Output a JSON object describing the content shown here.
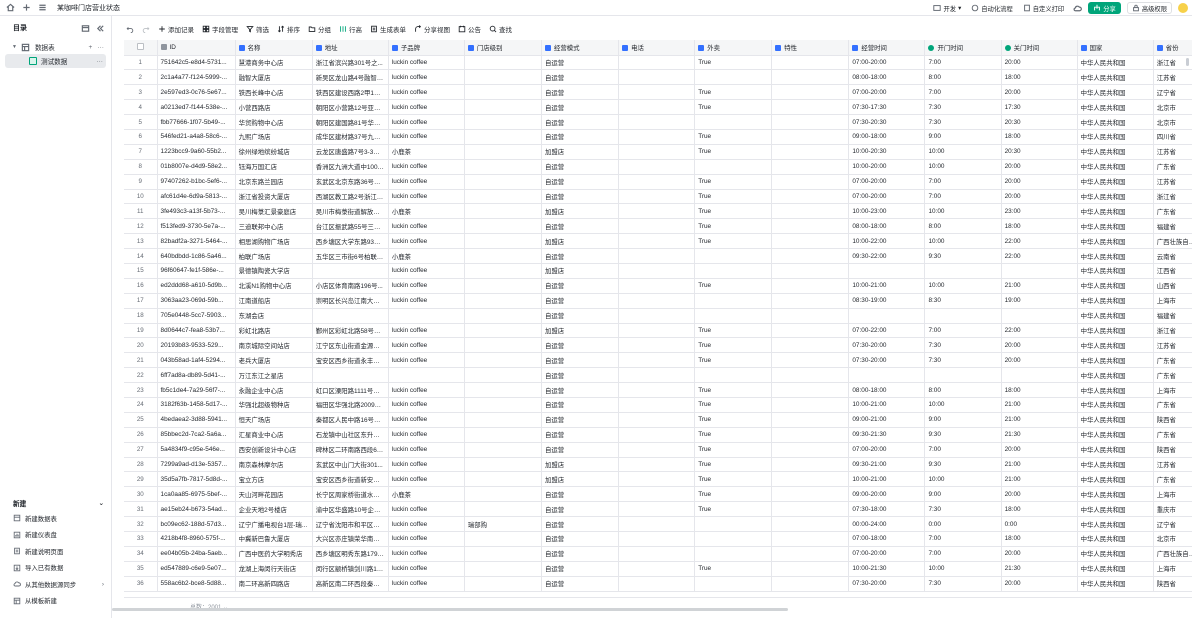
{
  "app": {
    "title": "某咖啡门店营业状态"
  },
  "topbar": {
    "actions": [
      "开发",
      "自动化流程",
      "自定义打印",
      "分享",
      "高级权限"
    ]
  },
  "sidebar": {
    "heading": "目录",
    "table_name": "数据表",
    "view_name": "测试数据",
    "new_heading": "新建",
    "new_items": [
      {
        "label": "新建数据表",
        "icon": "table-icon"
      },
      {
        "label": "新建仪表盘",
        "icon": "dashboard-icon"
      },
      {
        "label": "新建说明页面",
        "icon": "doc-icon"
      },
      {
        "label": "导入已有数据",
        "icon": "import-icon"
      },
      {
        "label": "从其他数据源同步",
        "icon": "cloud-icon"
      },
      {
        "label": "从模板新建",
        "icon": "template-icon"
      }
    ]
  },
  "toolbar": {
    "add_record": "添加记录",
    "fields": "字段管理",
    "filter": "筛选",
    "sort": "排序",
    "group": "分组",
    "row_height": "行高",
    "form": "生成表单",
    "share_view": "分享视图",
    "notice": "公告",
    "search": "查找"
  },
  "columns": [
    "ID",
    "名称",
    "地址",
    "子品牌",
    "门店级别",
    "经营模式",
    "电话",
    "外卖",
    "特性",
    "经营时间",
    "开门时间",
    "关门时间",
    "国家",
    "省份"
  ],
  "rows": [
    [
      "1",
      "751642c5-e8d4-5731...",
      "慧港商务中心店",
      "浙江省滨兴路301号之...",
      "luckin coffee",
      "",
      "自运营",
      "",
      "True",
      "",
      "07:00-20:00",
      "7:00",
      "20:00",
      "中华人民共和国",
      "浙江省"
    ],
    [
      "2",
      "2c1a4a77-f124-5999-...",
      "融智大厦店",
      "新吴区龙山路4号融智大...",
      "luckin coffee",
      "",
      "自运营",
      "",
      "",
      "",
      "08:00-18:00",
      "8:00",
      "18:00",
      "中华人民共和国",
      "江苏省"
    ],
    [
      "3",
      "2e597ed3-0c76-5e67...",
      "铁西长峰中心店",
      "铁西区建设西路2甲1号...",
      "luckin coffee",
      "",
      "自运营",
      "",
      "True",
      "",
      "07:00-20:00",
      "7:00",
      "20:00",
      "中华人民共和国",
      "辽宁省"
    ],
    [
      "4",
      "a0213ed7-f144-538e-...",
      "小营西路店",
      "朝阳区小营路12号亚运...",
      "luckin coffee",
      "",
      "自运营",
      "",
      "True",
      "",
      "07:30-17:30",
      "7:30",
      "17:30",
      "中华人民共和国",
      "北京市"
    ],
    [
      "5",
      "fbb77666-1f07-5b49-...",
      "华贸购物中心店",
      "朝阳区建国路81号华贸...",
      "luckin coffee",
      "",
      "自运营",
      "",
      "",
      "",
      "07:30-20:30",
      "7:30",
      "20:30",
      "中华人民共和国",
      "北京市"
    ],
    [
      "6",
      "546fed21-a4a8-58c6-...",
      "九熙广场店",
      "成华区建材路37号九熙...",
      "luckin coffee",
      "",
      "自运营",
      "",
      "True",
      "",
      "09:00-18:00",
      "9:00",
      "18:00",
      "中华人民共和国",
      "四川省"
    ],
    [
      "7",
      "1223bcc9-9a60-55b2...",
      "徐州绿地缤纷城店",
      "云龙区唐盛路7号3-3地...",
      "小鹿茶",
      "",
      "加盟店",
      "",
      "True",
      "",
      "10:00-20:30",
      "10:00",
      "20:30",
      "中华人民共和国",
      "江苏省"
    ],
    [
      "8",
      "01b8007e-d4d9-58e2...",
      "钰海万国汇店",
      "香洲区九洲大道中1009...",
      "luckin coffee",
      "",
      "自运营",
      "",
      "",
      "",
      "10:00-20:00",
      "10:00",
      "20:00",
      "中华人民共和国",
      "广东省"
    ],
    [
      "9",
      "97407262-b1bc-5ef6-...",
      "北京东路兰园店",
      "玄武区北京东路36号的...",
      "luckin coffee",
      "",
      "自运营",
      "",
      "True",
      "",
      "07:00-20:00",
      "7:00",
      "20:00",
      "中华人民共和国",
      "江苏省"
    ],
    [
      "10",
      "afc61d4e-6d9a-5813-...",
      "浙江省投资大厦店",
      "西湖区教工路2号浙江省...",
      "luckin coffee",
      "",
      "自运营",
      "",
      "True",
      "",
      "07:00-20:00",
      "7:00",
      "20:00",
      "中华人民共和国",
      "浙江省"
    ],
    [
      "11",
      "3fe493c3-a13f-5b73-...",
      "吴川梅菉汇景豪庭店",
      "吴川市梅菉街道解放中...",
      "小鹿茶",
      "",
      "加盟店",
      "",
      "True",
      "",
      "10:00-23:00",
      "10:00",
      "23:00",
      "中华人民共和国",
      "广东省"
    ],
    [
      "12",
      "f513fed9-3730-5e7a-...",
      "三迪联邦中心店",
      "台江区振武路55号三迪...",
      "luckin coffee",
      "",
      "自运营",
      "",
      "True",
      "",
      "08:00-18:00",
      "8:00",
      "18:00",
      "中华人民共和国",
      "福建省"
    ],
    [
      "13",
      "82badf2a-3271-5464-...",
      "相思湖购物广场店",
      "西乡塘区大学东路93号...",
      "luckin coffee",
      "",
      "加盟店",
      "",
      "True",
      "",
      "10:00-22:00",
      "10:00",
      "22:00",
      "中华人民共和国",
      "广西壮族自治区"
    ],
    [
      "14",
      "640bdbdd-1c86-5a46...",
      "柏联广场店",
      "五华区三市街6号柏联广...",
      "小鹿茶",
      "",
      "自运营",
      "",
      "",
      "",
      "09:30-22:00",
      "9:30",
      "22:00",
      "中华人民共和国",
      "云南省"
    ],
    [
      "15",
      "96f60647-fe1f-586e-...",
      "景德镇陶瓷大学店",
      "",
      "luckin coffee",
      "",
      "加盟店",
      "",
      "",
      "",
      "",
      "",
      "",
      "中华人民共和国",
      "江西省"
    ],
    [
      "16",
      "ed2ddd68-a610-5d9b...",
      "北溪N1购物中心店",
      "小店区体育南路196号...",
      "luckin coffee",
      "",
      "自运营",
      "",
      "True",
      "",
      "10:00-21:00",
      "10:00",
      "21:00",
      "中华人民共和国",
      "山西省"
    ],
    [
      "17",
      "3063aa23-069d-59b...",
      "江南道船店",
      "崇明区长兴岛江南大道9...",
      "luckin coffee",
      "",
      "自运营",
      "",
      "",
      "",
      "08:30-19:00",
      "8:30",
      "19:00",
      "中华人民共和国",
      "上海市"
    ],
    [
      "18",
      "705e0448-5cc7-5903...",
      "东湖会店",
      "",
      "",
      "",
      "自运营",
      "",
      "",
      "",
      "",
      "",
      "",
      "中华人民共和国",
      "福建省"
    ],
    [
      "19",
      "8d0644c7-fea8-53b7...",
      "彩虹北路店",
      "鄞州区彩虹北路58号江...",
      "luckin coffee",
      "",
      "加盟店",
      "",
      "True",
      "",
      "07:00-22:00",
      "7:00",
      "22:00",
      "中华人民共和国",
      "浙江省"
    ],
    [
      "20",
      "20193b83-9533-529...",
      "南京城际空间站店",
      "江宁区东山街道金源路4...",
      "luckin coffee",
      "",
      "自运营",
      "",
      "True",
      "",
      "07:30-20:00",
      "7:30",
      "20:00",
      "中华人民共和国",
      "江苏省"
    ],
    [
      "21",
      "043b58ad-1af4-5294...",
      "老兵大厦店",
      "宝安区西乡街道永丰社...",
      "luckin coffee",
      "",
      "自运营",
      "",
      "True",
      "",
      "07:30-20:00",
      "7:30",
      "20:00",
      "中华人民共和国",
      "广东省"
    ],
    [
      "22",
      "6ff7ad8a-db89-5d41-...",
      "万江东江之星店",
      "",
      "",
      "",
      "自运营",
      "",
      "",
      "",
      "",
      "",
      "",
      "中华人民共和国",
      "广东省"
    ],
    [
      "23",
      "fb5c1de4-7a29-56f7-...",
      "永融企业中心店",
      "虹口区溧阳路1111号永...",
      "luckin coffee",
      "",
      "自运营",
      "",
      "True",
      "",
      "08:00-18:00",
      "8:00",
      "18:00",
      "中华人民共和国",
      "上海市"
    ],
    [
      "24",
      "3182f63b-1458-5d17-...",
      "华强北超级物种店",
      "福田区华强北路2009号...",
      "luckin coffee",
      "",
      "自运营",
      "",
      "True",
      "",
      "10:00-21:00",
      "10:00",
      "21:00",
      "中华人民共和国",
      "广东省"
    ],
    [
      "25",
      "4bedaea2-3d88-5941...",
      "恒天广场店",
      "秦都区人民中路16号中...",
      "luckin coffee",
      "",
      "自运营",
      "",
      "True",
      "",
      "09:00-21:00",
      "9:00",
      "21:00",
      "中华人民共和国",
      "陕西省"
    ],
    [
      "26",
      "85bbec2d-7ca2-5a6a...",
      "汇星商业中心店",
      "石龙镇中山社区东升路1...",
      "luckin coffee",
      "",
      "自运营",
      "",
      "True",
      "",
      "09:30-21:30",
      "9:30",
      "21:30",
      "中华人民共和国",
      "广东省"
    ],
    [
      "27",
      "5a4834f9-c95e-546e...",
      "西安创新设计中心店",
      "碑林区二环南路西段69...",
      "luckin coffee",
      "",
      "自运营",
      "",
      "True",
      "",
      "07:00-20:00",
      "7:00",
      "20:00",
      "中华人民共和国",
      "陕西省"
    ],
    [
      "28",
      "7299a9ad-d13e-5357...",
      "南京森林摩尔店",
      "玄武区中山门大街301...",
      "luckin coffee",
      "",
      "加盟店",
      "",
      "True",
      "",
      "09:30-21:00",
      "9:30",
      "21:00",
      "中华人民共和国",
      "江苏省"
    ],
    [
      "29",
      "35d5a7fb-7817-5d8d-...",
      "宝立方店",
      "宝安区西乡街道新安四...",
      "luckin coffee",
      "",
      "加盟店",
      "",
      "True",
      "",
      "10:00-21:00",
      "10:00",
      "21:00",
      "中华人民共和国",
      "广东省"
    ],
    [
      "30",
      "1ca0aa85-6975-5bef-...",
      "天山河畔花园店",
      "长宁区周家桥街道水城...",
      "小鹿茶",
      "",
      "自运营",
      "",
      "True",
      "",
      "09:00-20:00",
      "9:00",
      "20:00",
      "中华人民共和国",
      "上海市"
    ],
    [
      "31",
      "ae15eb24-b673-54ad...",
      "企业天地2号楼店",
      "渝中区华盛路10号企业...",
      "luckin coffee",
      "",
      "自运营",
      "",
      "True",
      "",
      "07:30-18:00",
      "7:30",
      "18:00",
      "中华人民共和国",
      "重庆市"
    ],
    [
      "32",
      "bc09ec62-188d-57d3...",
      "辽宁广播电视台1层-瑞...",
      "辽宁省沈阳市和平区南...",
      "luckin coffee",
      "瑞部购",
      "自运营",
      "",
      "",
      "",
      "00:00-24:00",
      "0:00",
      "0:00",
      "中华人民共和国",
      "辽宁省"
    ],
    [
      "33",
      "4218b4f8-8960-575f-...",
      "中冀新巴鲁大厦店",
      "大兴区亦庄镇荣华南路1...",
      "luckin coffee",
      "",
      "自运营",
      "",
      "",
      "",
      "07:00-18:00",
      "7:00",
      "18:00",
      "中华人民共和国",
      "北京市"
    ],
    [
      "34",
      "ee04b05b-24ba-5aeb...",
      "广西中医药大学明秀店",
      "西乡塘区明秀东路179号...",
      "luckin coffee",
      "",
      "自运营",
      "",
      "",
      "",
      "07:00-20:00",
      "7:00",
      "20:00",
      "中华人民共和国",
      "广西壮族自治区"
    ],
    [
      "35",
      "ed547889-c6e9-5e07...",
      "龙湖上海闵行天街店",
      "闵行区颛桥镇剑川路10...",
      "luckin coffee",
      "",
      "自运营",
      "",
      "True",
      "",
      "10:00-21:30",
      "10:00",
      "21:30",
      "中华人民共和国",
      "上海市"
    ],
    [
      "36",
      "558ac6b2-bce8-5d88...",
      "南二环高新四路店",
      "高新区南二环西段秦华...",
      "luckin coffee",
      "",
      "自运营",
      "",
      "",
      "",
      "07:30-20:00",
      "7:30",
      "20:00",
      "中华人民共和国",
      "陕西省"
    ]
  ],
  "footer": {
    "count": "总数：2001"
  }
}
